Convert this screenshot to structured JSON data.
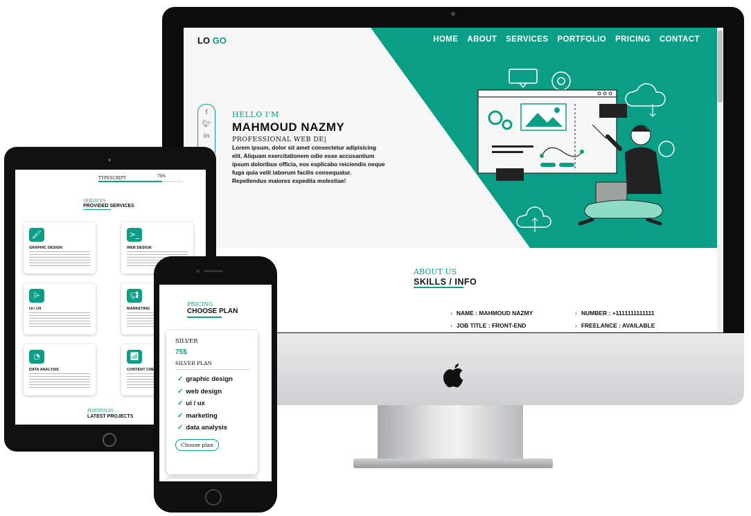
{
  "site": {
    "logo": {
      "part1": "LO",
      "part2": "GO"
    },
    "nav": [
      "HOME",
      "ABOUT",
      "SERVICES",
      "PORTFOLIO",
      "PRICING",
      "CONTACT"
    ],
    "social_icons": [
      "facebook-icon",
      "twitter-icon",
      "linkedin-icon"
    ],
    "hero": {
      "greeting": "HELLO I'M",
      "name": "MAHMOUD NAZMY",
      "role": "PROFESSIONAL WEB DE|",
      "lorem_lines": [
        "Lorem ipsum, dolor sit amet consectetur adipisicing",
        "elit. Aliquam exercitationem odio esse accusantium",
        "ipsum doloribus officia, eos explicabo reiciendis neque",
        "fuga quia velit laborum facilis consequatur.",
        "Repellendus maiores expedita molestiae!"
      ]
    },
    "about": {
      "subtitle": "ABOUT US",
      "title": "SKILLS / INFO",
      "info": [
        {
          "label": "NAME : MAHMOUD NAZMY"
        },
        {
          "label": "NUMBER : +1111111111111"
        },
        {
          "label": "JOB TITLE : FRONT-END"
        },
        {
          "label": "FREELANCE : AVAILABLE"
        }
      ]
    },
    "colors": {
      "accent": "#0b9e87",
      "dark": "#111111",
      "hero_bg": "#f6f6f6"
    }
  },
  "tablet": {
    "skill_label": "TYPESCRIPT",
    "skill_percent": "75%",
    "skill_level": 0.75,
    "services_subtitle": "SERVICES",
    "services_title": "PROVIDED SERVICES",
    "services": [
      {
        "title": "GRAPHIC DESIGN",
        "icon": "brush-icon"
      },
      {
        "title": "WEB DESIGN",
        "icon": "terminal-icon"
      },
      {
        "title": "UI / UX",
        "icon": "vector-icon"
      },
      {
        "title": "MARKETING",
        "icon": "megaphone-icon"
      },
      {
        "title": "DATA ANALYSIS",
        "icon": "pie-chart-icon"
      },
      {
        "title": "CONTENT CRE",
        "icon": "signal-icon"
      }
    ],
    "portfolio_subtitle": "PORTFOLIO",
    "portfolio_title": "LATEST PROJECTS"
  },
  "phone": {
    "pricing_subtitle": "PRICING",
    "pricing_title": "CHOOSE PLAN",
    "plan": {
      "name": "SILVER",
      "price": "75$",
      "label": "SILVER PLAN",
      "features": [
        "graphic design",
        "web design",
        "ui / ux",
        "marketing",
        "data analysis"
      ],
      "button": "Choose plan"
    }
  }
}
